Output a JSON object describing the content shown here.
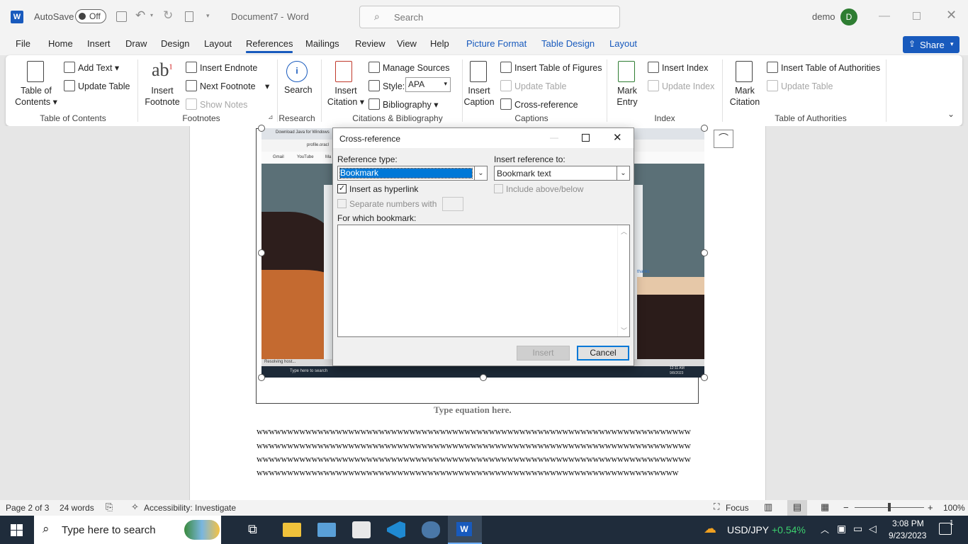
{
  "titlebar": {
    "autosave_label": "AutoSave",
    "autosave_state": "Off",
    "doc_title": "Document7",
    "app_name": "Word",
    "separator": "-",
    "search_placeholder": "Search",
    "user_name": "demo",
    "avatar_initial": "D"
  },
  "tabs": [
    "File",
    "Home",
    "Insert",
    "Draw",
    "Design",
    "Layout",
    "References",
    "Mailings",
    "Review",
    "View",
    "Help",
    "Picture Format",
    "Table Design",
    "Layout"
  ],
  "active_tab": "References",
  "share_label": "Share",
  "ribbon": {
    "toc": {
      "big": "Table of Contents",
      "line1": "Table of",
      "line2": "Contents",
      "add_text": "Add Text",
      "update_table": "Update Table",
      "group": "Table of Contents"
    },
    "footnotes": {
      "insert_footnote_1": "Insert",
      "insert_footnote_2": "Footnote",
      "ab": "ab",
      "sup": "1",
      "insert_endnote": "Insert Endnote",
      "next_footnote": "Next Footnote",
      "show_notes": "Show Notes",
      "group": "Footnotes"
    },
    "research": {
      "search": "Search",
      "group": "Research"
    },
    "citations": {
      "insert_citation_1": "Insert",
      "insert_citation_2": "Citation",
      "manage_sources": "Manage Sources",
      "style_label": "Style:",
      "style_value": "APA",
      "bibliography": "Bibliography",
      "group": "Citations & Bibliography"
    },
    "captions": {
      "insert_caption_1": "Insert",
      "insert_caption_2": "Caption",
      "insert_tof": "Insert Table of Figures",
      "update_table": "Update Table",
      "cross_reference": "Cross-reference",
      "group": "Captions"
    },
    "index": {
      "mark_entry_1": "Mark",
      "mark_entry_2": "Entry",
      "insert_index": "Insert Index",
      "update_index": "Update Index",
      "group": "Index"
    },
    "toa": {
      "mark_citation_1": "Mark",
      "mark_citation_2": "Citation",
      "insert_toa": "Insert Table of Authorities",
      "update_table": "Update Table",
      "group": "Table of Authorities"
    }
  },
  "document": {
    "equation_placeholder": "Type equation here.",
    "lines": [
      "wwwwwwwwwwwwwwwwwwwwwwwwwwwwwwwwwwwwwwwwwwwwwwwwwwwwwwwwwwwwwwwwwwwwwww",
      "wwwwwwwwwwwwwwwwwwwwwwwwwwwwwwwwwwwwwwwwwwwwwwwwwwwwwwwwwwwwwwwwwwwwwww",
      "wwwwwwwwwwwwwwwwwwwwwwwwwwwwwwwwwwwwwwwwwwwwwwwwwwwwwwwwwwwwwwwwwwwwwww",
      "wwwwwwwwwwwwwwwwwwwwwwwwwwwwwwwwwwwwwwwwwwwwwwwwwwwwwwwwwwwwwwwwwwwww"
    ],
    "screenshot_texts": {
      "tab_title": "Download Java for Windows",
      "url": "profile.oracl",
      "bm_gmail": "Gmail",
      "bm_youtube": "YouTube",
      "bm_maps": "Ma",
      "status": "Resolving host...",
      "search": "Type here to search",
      "time": "12:11 AM",
      "date": "9/8/2023",
      "thanks": "thanks"
    }
  },
  "dialog": {
    "title": "Cross-reference",
    "reference_type_label": "Reference type:",
    "reference_type_value": "Bookmark",
    "insert_reference_label": "Insert reference to:",
    "insert_reference_value": "Bookmark text",
    "insert_hyperlink_label": "Insert as hyperlink",
    "include_above_below_label": "Include above/below",
    "separate_numbers_label": "Separate numbers with",
    "for_which_label": "For which bookmark:",
    "insert_button": "Insert",
    "cancel_button": "Cancel"
  },
  "statusbar": {
    "page": "Page 2 of 3",
    "words": "24 words",
    "accessibility": "Accessibility: Investigate",
    "focus": "Focus",
    "zoom": "100%",
    "minus": "−",
    "plus": "+"
  },
  "taskbar": {
    "search_placeholder": "Type here to search",
    "ticker": "USD/JPY",
    "ticker_change": "+0.54%",
    "time": "3:08 PM",
    "date": "9/23/2023",
    "notif_count": "1"
  },
  "colors": {
    "accent": "#185abd",
    "share_bg": "#185abd",
    "taskbar": "#1f2c3b",
    "ticker_up": "#3ccf6e",
    "avatar": "#2e7d32"
  }
}
